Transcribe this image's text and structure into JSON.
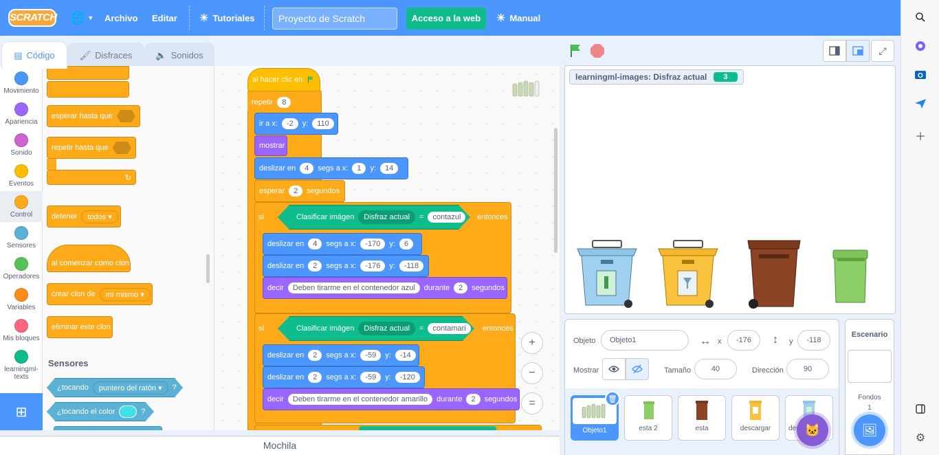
{
  "menubar": {
    "logo": "SCRATCH",
    "file": "Archivo",
    "edit": "Editar",
    "tutorials": "Tutoriales",
    "project_title": "Proyecto de Scratch",
    "web_access": "Acceso a la web",
    "manual": "Manual"
  },
  "tabs": {
    "code": "Código",
    "costumes": "Disfraces",
    "sounds": "Sonidos"
  },
  "categories": [
    {
      "label": "Movimiento",
      "color": "#4c97ff"
    },
    {
      "label": "Apariencia",
      "color": "#9966ff"
    },
    {
      "label": "Sonido",
      "color": "#cf63cf"
    },
    {
      "label": "Eventos",
      "color": "#ffbf00"
    },
    {
      "label": "Control",
      "color": "#ffab19"
    },
    {
      "label": "Sensores",
      "color": "#5cb1d6"
    },
    {
      "label": "Operadores",
      "color": "#59c059"
    },
    {
      "label": "Variables",
      "color": "#ff8c1a"
    },
    {
      "label": "Mis bloques",
      "color": "#ff6680"
    },
    {
      "label": "learningml-texts",
      "color": "#0fbd8c"
    }
  ],
  "palette": {
    "wait_until": "esperar hasta que",
    "repeat_until": "repetir hasta que",
    "stop": "detener",
    "stop_option": "todos",
    "when_clone": "al comenzar como clon",
    "create_clone": "crear clon de",
    "clone_option": "mí mismo",
    "delete_clone": "eliminar este clon",
    "sensing_title": "Sensores",
    "touching": "¿tocando",
    "touching_option": "puntero del ratón",
    "touching_color": "¿tocando el color",
    "q": "?"
  },
  "script": {
    "when_flag": "al hacer clic en",
    "repeat": "repetir",
    "repeat_n": "8",
    "goto": "ir a x:",
    "goto_x": "-2",
    "y_label": "y:",
    "goto_y": "110",
    "show": "mostrar",
    "glide": "deslizar en",
    "glide1_t": "4",
    "secs_to_x": "segs a x:",
    "glide1_x": "1",
    "glide1_y": "14",
    "wait": "esperar",
    "wait_n": "2",
    "seconds": "segundos",
    "if": "si",
    "classify": "Clasificar imágen",
    "costume": "Disfraz actual",
    "eq": "=",
    "then": "entonces",
    "label_blue": "contazul",
    "glide2_t": "4",
    "glide2_x": "-170",
    "glide2_y": "6",
    "glide3_t": "2",
    "glide3_x": "-176",
    "glide3_y": "-118",
    "say": "decir",
    "say_blue": "Deben tirarme en el contenedor azul",
    "during": "durante",
    "say1_n": "2",
    "label_yellow": "contamari",
    "glide4_t": "2",
    "glide4_x": "-59",
    "glide4_y": "-14",
    "glide5_t": "2",
    "glide5_x": "-59",
    "glide5_y": "-120",
    "say_yellow": "Deben tirarme en el contenedor amarillo",
    "say2_n": "2"
  },
  "zoom": {
    "in": "+",
    "out": "−",
    "reset": "="
  },
  "stage": {
    "monitor_label": "learningml-images: Disfraz actual",
    "monitor_value": "3"
  },
  "sprite_info": {
    "sprite_label": "Objeto",
    "sprite_name": "Objeto1",
    "x_label": "x",
    "x_value": "-176",
    "y_label": "y",
    "y_value": "-118",
    "show_label": "Mostrar",
    "size_label": "Tamaño",
    "size_value": "40",
    "direction_label": "Dirección",
    "direction_value": "90"
  },
  "sprites": [
    {
      "name": "Objeto1"
    },
    {
      "name": "esta 2"
    },
    {
      "name": "esta"
    },
    {
      "name": "descargar"
    },
    {
      "name": "descargar"
    }
  ],
  "stage_pane": {
    "title": "Escenario",
    "backdrops": "Fondos",
    "backdrop_count": "1"
  },
  "mochila": "Mochila",
  "colors": {
    "accent": "#4c97ff",
    "control": "#ffab19",
    "motion": "#4c97ff",
    "looks": "#9966ff",
    "ml": "#0fbd8c"
  }
}
